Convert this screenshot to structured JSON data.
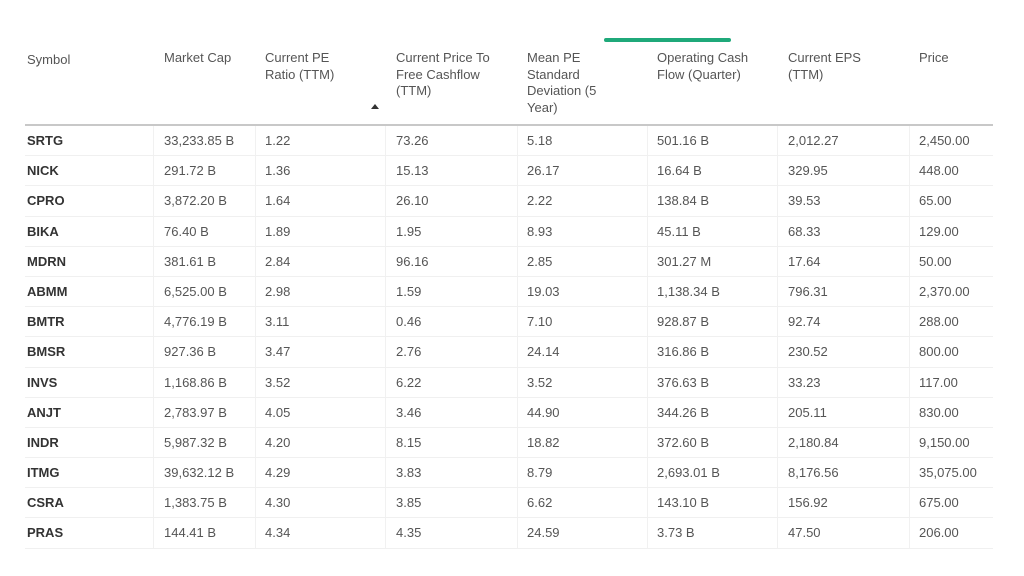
{
  "table": {
    "active_tab_color": "#1fa97a",
    "sorted_column": "Current PE Ratio (TTM)",
    "sort_direction": "ascending",
    "headers": [
      "Symbol",
      "Market Cap",
      "Current PE Ratio (TTM)",
      "Current Price To Free Cashflow (TTM)",
      "Mean PE Standard Deviation (5 Year)",
      "Operating Cash Flow (Quarter)",
      "Current EPS (TTM)",
      "Price"
    ],
    "rows": [
      [
        "SRTG",
        "33,233.85 B",
        "1.22",
        "73.26",
        "5.18",
        "501.16 B",
        "2,012.27",
        "2,450.00"
      ],
      [
        "NICK",
        "291.72 B",
        "1.36",
        "15.13",
        "26.17",
        "16.64 B",
        "329.95",
        "448.00"
      ],
      [
        "CPRO",
        "3,872.20 B",
        "1.64",
        "26.10",
        "2.22",
        "138.84 B",
        "39.53",
        "65.00"
      ],
      [
        "BIKA",
        "76.40 B",
        "1.89",
        "1.95",
        "8.93",
        "45.11 B",
        "68.33",
        "129.00"
      ],
      [
        "MDRN",
        "381.61 B",
        "2.84",
        "96.16",
        "2.85",
        "301.27 M",
        "17.64",
        "50.00"
      ],
      [
        "ABMM",
        "6,525.00 B",
        "2.98",
        "1.59",
        "19.03",
        "1,138.34 B",
        "796.31",
        "2,370.00"
      ],
      [
        "BMTR",
        "4,776.19 B",
        "3.11",
        "0.46",
        "7.10",
        "928.87 B",
        "92.74",
        "288.00"
      ],
      [
        "BMSR",
        "927.36 B",
        "3.47",
        "2.76",
        "24.14",
        "316.86 B",
        "230.52",
        "800.00"
      ],
      [
        "INVS",
        "1,168.86 B",
        "3.52",
        "6.22",
        "3.52",
        "376.63 B",
        "33.23",
        "117.00"
      ],
      [
        "ANJT",
        "2,783.97 B",
        "4.05",
        "3.46",
        "44.90",
        "344.26 B",
        "205.11",
        "830.00"
      ],
      [
        "INDR",
        "5,987.32 B",
        "4.20",
        "8.15",
        "18.82",
        "372.60 B",
        "2,180.84",
        "9,150.00"
      ],
      [
        "ITMG",
        "39,632.12 B",
        "4.29",
        "3.83",
        "8.79",
        "2,693.01 B",
        "8,176.56",
        "35,075.00"
      ],
      [
        "CSRA",
        "1,383.75 B",
        "4.30",
        "3.85",
        "6.62",
        "143.10 B",
        "156.92",
        "675.00"
      ],
      [
        "PRAS",
        "144.41 B",
        "4.34",
        "4.35",
        "24.59",
        "3.73 B",
        "47.50",
        "206.00"
      ]
    ]
  }
}
